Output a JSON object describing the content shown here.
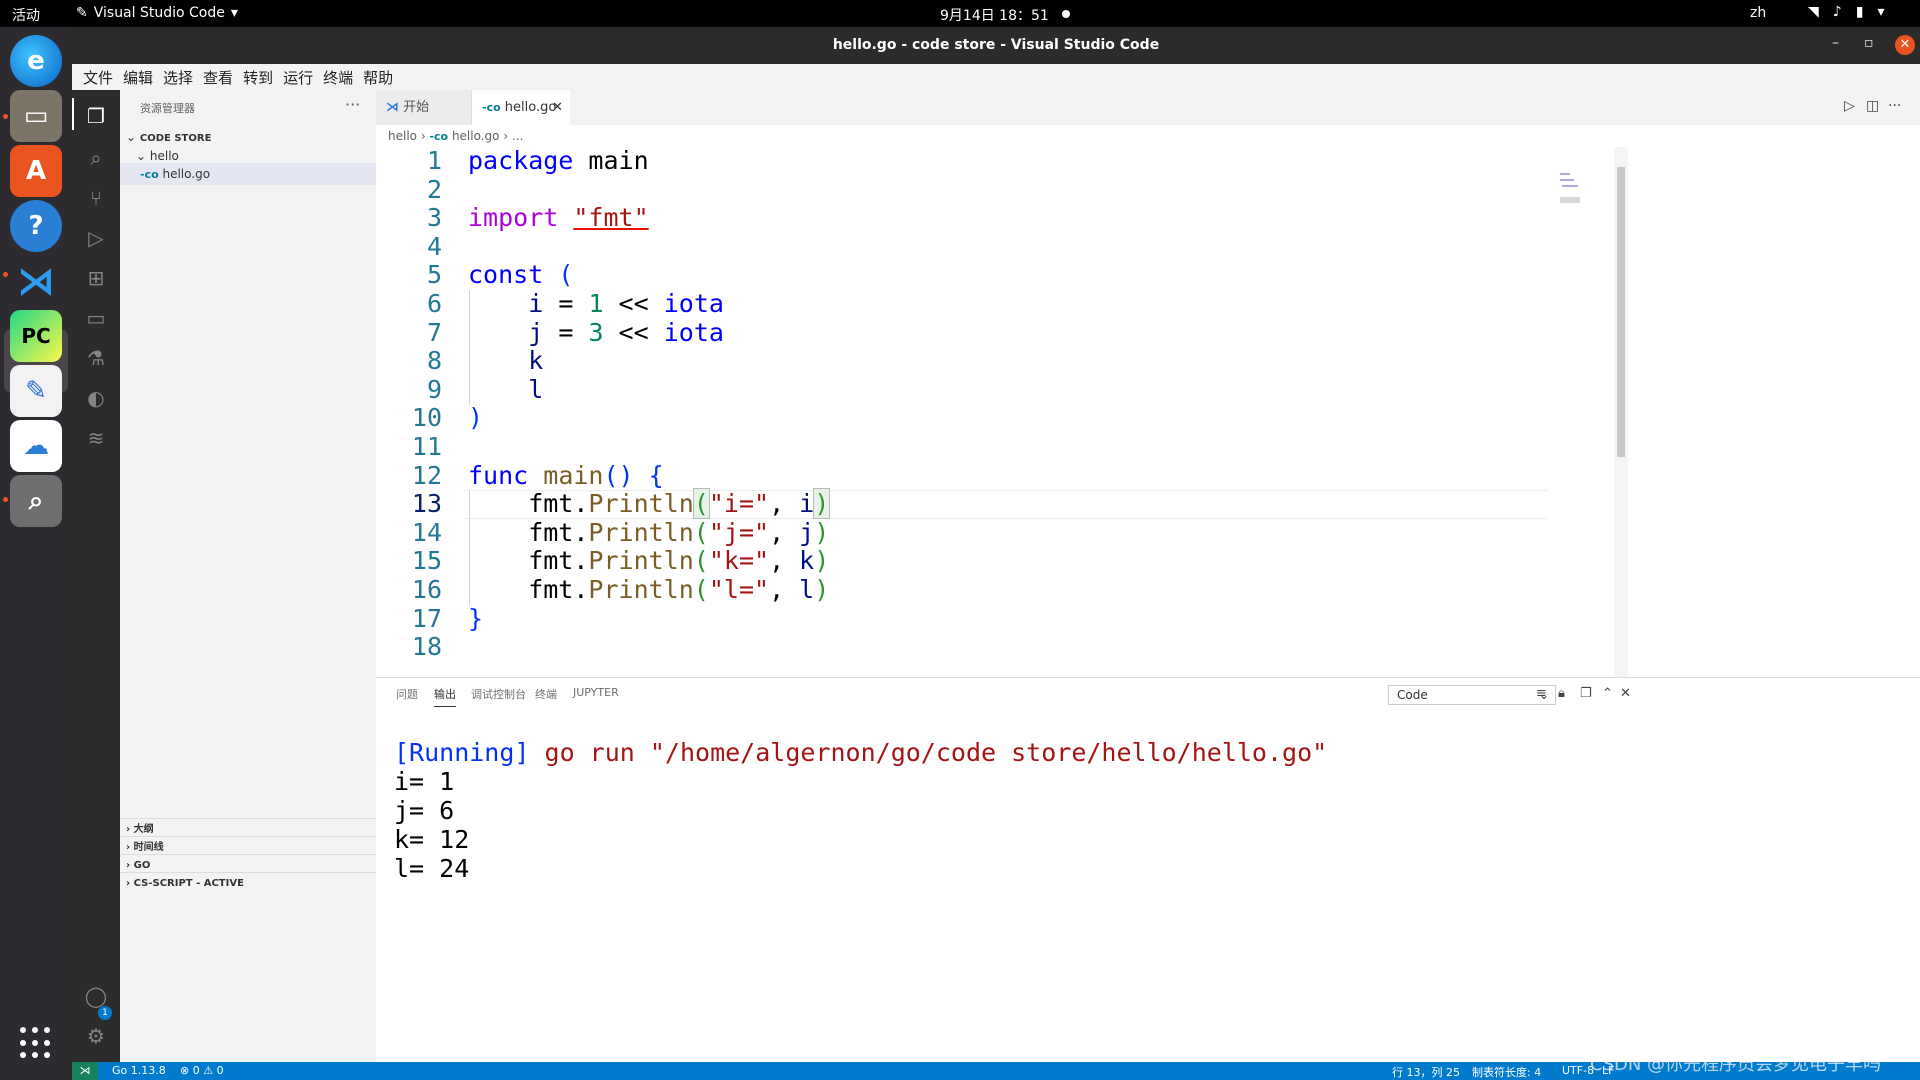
{
  "topbar": {
    "activities": "活动",
    "app_name": "Visual Studio Code",
    "clock": "9月14日  18：51",
    "lang": "zh"
  },
  "window": {
    "title": "hello.go - code store - Visual Studio Code"
  },
  "menu": [
    "文件",
    "编辑",
    "选择",
    "查看",
    "转到",
    "运行",
    "终端",
    "帮助"
  ],
  "sidebar": {
    "header": "资源管理器",
    "root": "CODE STORE",
    "folder": "hello",
    "file": "hello.go",
    "sections": [
      "大纲",
      "时间线",
      "GO",
      "CS-SCRIPT - ACTIVE"
    ]
  },
  "tabs": {
    "start": "开始",
    "active": "hello.go"
  },
  "breadcrumb": {
    "folder": "hello",
    "file": "hello.go",
    "more": "..."
  },
  "editor": {
    "line_numbers": [
      "1",
      "2",
      "3",
      "4",
      "5",
      "6",
      "7",
      "8",
      "9",
      "10",
      "11",
      "12",
      "13",
      "14",
      "15",
      "16",
      "17",
      "18"
    ],
    "current_line": "13"
  },
  "panel": {
    "tabs": [
      "问题",
      "输出",
      "调试控制台",
      "终端",
      "JUPYTER"
    ],
    "active_tab": "输出",
    "select_value": "Code",
    "output": {
      "running": "[Running]",
      "command": " go run \"/home/algernon/go/code store/hello/hello.go\"",
      "lines": [
        "i= 1",
        "j= 6",
        "k= 12",
        "l= 24"
      ]
    }
  },
  "statusbar": {
    "go_version": "Go 1.13.8",
    "problems": "0",
    "warnings": "0",
    "position": "行 13，列 25",
    "indent": "制表符长度: 4",
    "encoding": "UTF-8",
    "eol": "LF"
  },
  "watermark": "CSDN @你先程序员会梦见电子羊吗",
  "colors": {
    "statusbar": "#007acc",
    "accent": "#e95420"
  }
}
